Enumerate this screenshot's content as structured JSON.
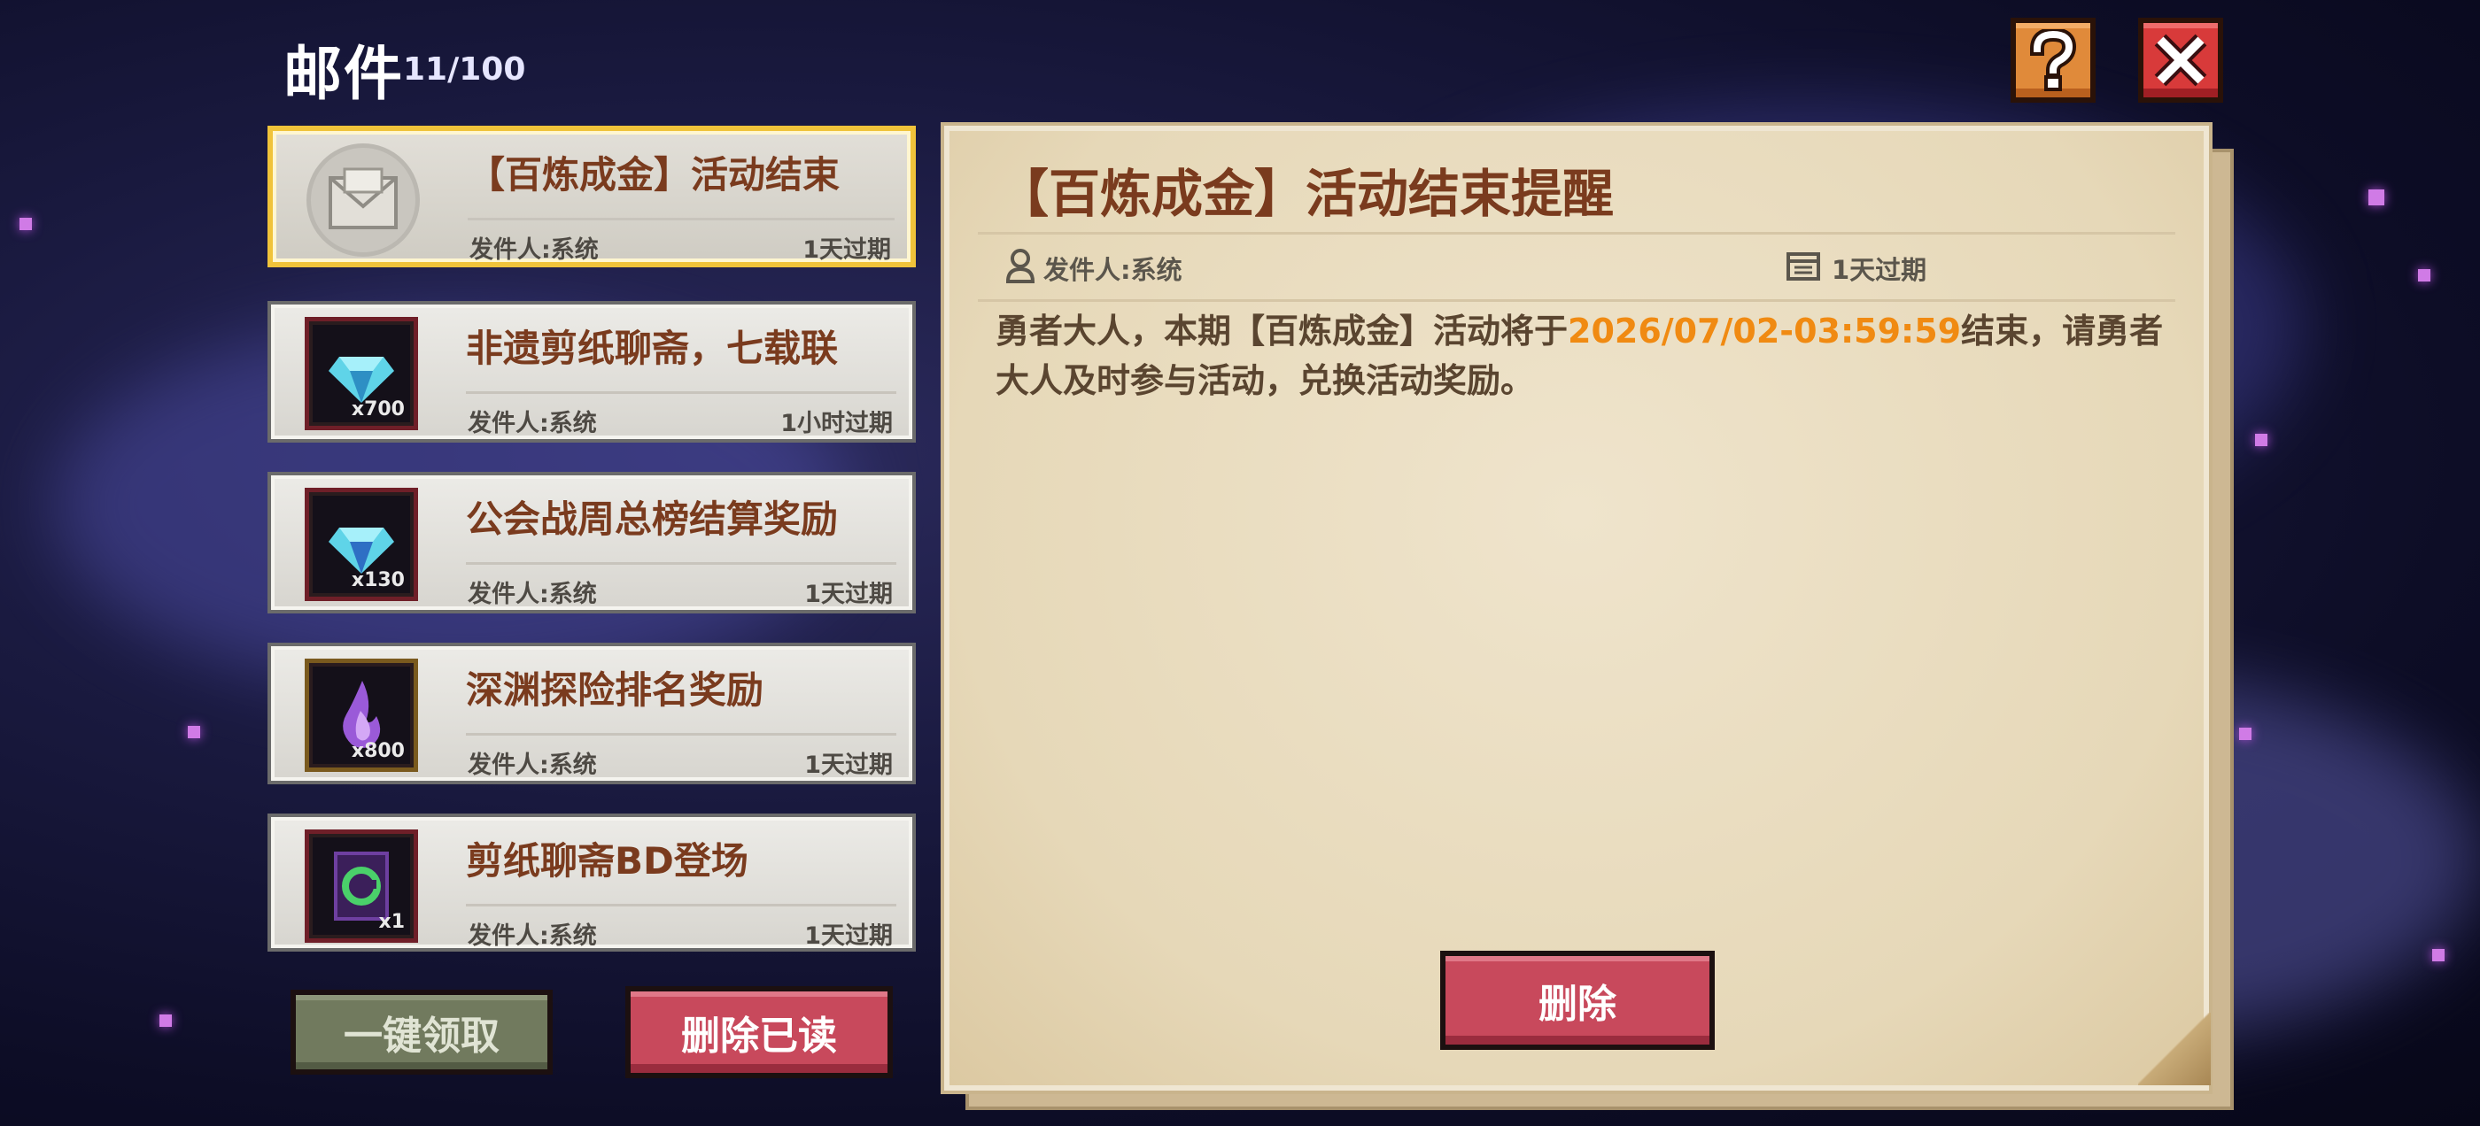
{
  "header": {
    "title": "邮件",
    "count": "11/100"
  },
  "buttons": {
    "help_icon": "question-icon",
    "close_icon": "close-icon",
    "claim_all": "一键领取",
    "delete_read": "删除已读",
    "delete": "删除"
  },
  "mails": [
    {
      "title": "【百炼成金】活动结束",
      "sender": "发件人:系统",
      "expire": "1天过期",
      "icon": "envelope-icon",
      "qty": ""
    },
    {
      "title": "非遗剪纸聊斋，七载联",
      "sender": "发件人:系统",
      "expire": "1小时过期",
      "icon": "diamond-icon",
      "qty": "x700"
    },
    {
      "title": "公会战周总榜结算奖励",
      "sender": "发件人:系统",
      "expire": "1天过期",
      "icon": "diamond-icon",
      "qty": "x130"
    },
    {
      "title": "深渊探险排名奖励",
      "sender": "发件人:系统",
      "expire": "1天过期",
      "icon": "purple-flame-icon",
      "qty": "x800"
    },
    {
      "title": "剪纸聊斋BD登场",
      "sender": "发件人:系统",
      "expire": "1天过期",
      "icon": "green-card-icon",
      "qty": "x1"
    }
  ],
  "detail": {
    "title": "【百炼成金】活动结束提醒",
    "sender": "发件人:系统",
    "expire": "1天过期",
    "body_before": "勇者大人，本期【百炼成金】活动将于",
    "body_highlight": "2026/07/02-03:59:59",
    "body_after": "结束，请勇者大人及时参与活动，兑换活动奖励。"
  },
  "colors": {
    "title_brown": "#7a3b1e",
    "highlight_orange": "#f08a12",
    "selected_border": "#f0c33a",
    "delete_red": "#c8495c"
  }
}
